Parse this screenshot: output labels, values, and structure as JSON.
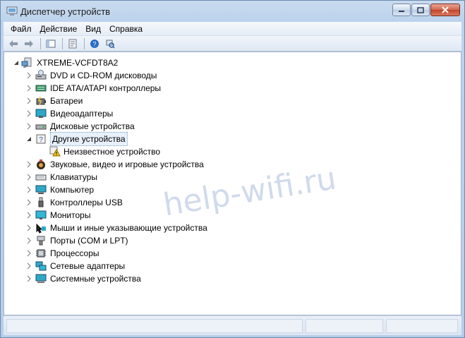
{
  "window": {
    "title": "Диспетчер устройств"
  },
  "menu": [
    {
      "label": "Файл"
    },
    {
      "label": "Действие"
    },
    {
      "label": "Вид"
    },
    {
      "label": "Справка"
    }
  ],
  "tree": {
    "root": "XTREME-VCFDT8A2",
    "categories": [
      {
        "label": "DVD и CD-ROM дисководы",
        "icon": "dvd-drive-icon"
      },
      {
        "label": "IDE ATA/ATAPI контроллеры",
        "icon": "ide-controller-icon"
      },
      {
        "label": "Батареи",
        "icon": "battery-icon"
      },
      {
        "label": "Видеоадаптеры",
        "icon": "display-adapter-icon"
      },
      {
        "label": "Дисковые устройства",
        "icon": "disk-drive-icon"
      },
      {
        "label": "Другие устройства",
        "icon": "other-devices-icon",
        "expanded": true,
        "selected": true,
        "children": [
          {
            "label": "Неизвестное устройство",
            "icon": "unknown-device-warning-icon"
          }
        ]
      },
      {
        "label": "Звуковые, видео и игровые устройства",
        "icon": "sound-device-icon"
      },
      {
        "label": "Клавиатуры",
        "icon": "keyboard-icon"
      },
      {
        "label": "Компьютер",
        "icon": "computer-icon"
      },
      {
        "label": "Контроллеры USB",
        "icon": "usb-controller-icon"
      },
      {
        "label": "Мониторы",
        "icon": "monitor-icon"
      },
      {
        "label": "Мыши и иные указывающие устройства",
        "icon": "mouse-icon"
      },
      {
        "label": "Порты (COM и LPT)",
        "icon": "port-icon"
      },
      {
        "label": "Процессоры",
        "icon": "processor-icon"
      },
      {
        "label": "Сетевые адаптеры",
        "icon": "network-adapter-icon"
      },
      {
        "label": "Системные устройства",
        "icon": "system-devices-icon"
      }
    ]
  },
  "watermark": "help-wifi.ru"
}
